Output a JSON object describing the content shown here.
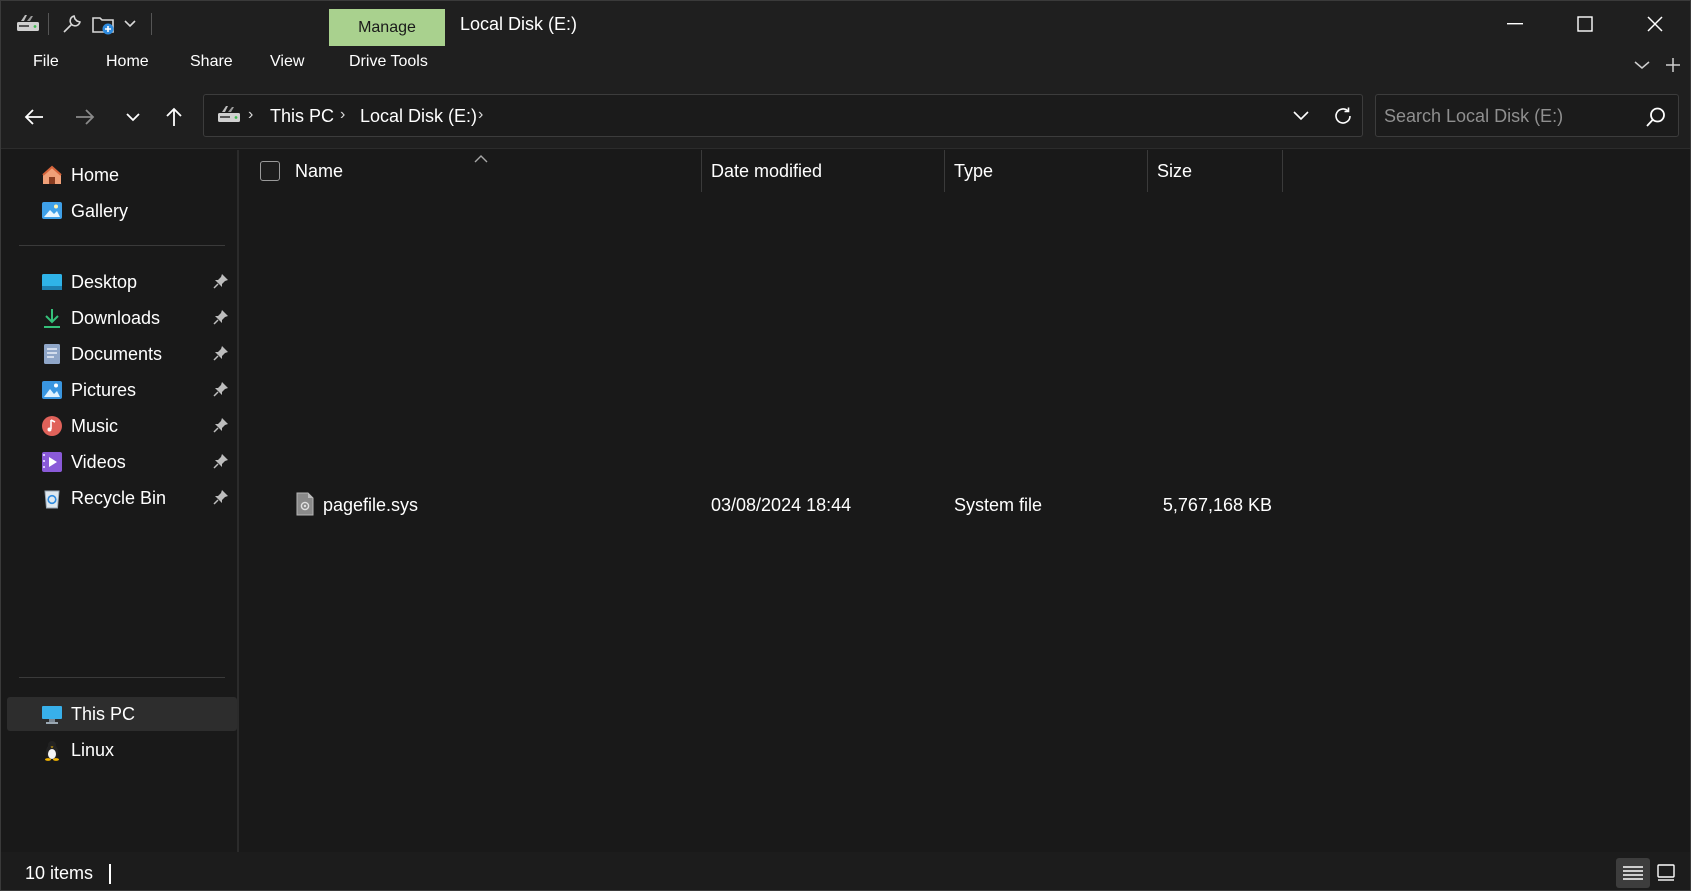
{
  "titlebar": {
    "manage_tab": "Manage",
    "window_title": "Local Disk (E:)"
  },
  "ribbon": {
    "tabs": [
      "File",
      "Home",
      "Share",
      "View",
      "Drive Tools"
    ]
  },
  "addressbar": {
    "crumbs": [
      "This PC",
      "Local Disk (E:)"
    ]
  },
  "search": {
    "placeholder": "Search Local Disk (E:)"
  },
  "sidebar": {
    "top_items": [
      {
        "label": "Home",
        "icon": "home-icon"
      },
      {
        "label": "Gallery",
        "icon": "gallery-icon"
      }
    ],
    "pinned_items": [
      {
        "label": "Desktop",
        "icon": "desktop-folder-icon"
      },
      {
        "label": "Downloads",
        "icon": "downloads-folder-icon"
      },
      {
        "label": "Documents",
        "icon": "documents-folder-icon"
      },
      {
        "label": "Pictures",
        "icon": "pictures-folder-icon"
      },
      {
        "label": "Music",
        "icon": "music-folder-icon"
      },
      {
        "label": "Videos",
        "icon": "videos-folder-icon"
      },
      {
        "label": "Recycle Bin",
        "icon": "recycle-bin-icon"
      }
    ],
    "bottom_items": [
      {
        "label": "This PC",
        "icon": "this-pc-icon",
        "selected": true
      },
      {
        "label": "Linux",
        "icon": "linux-penguin-icon"
      }
    ]
  },
  "columns": {
    "name": "Name",
    "date_modified": "Date modified",
    "type": "Type",
    "size": "Size"
  },
  "files": [
    {
      "name": "pagefile.sys",
      "date_modified": "03/08/2024 18:44",
      "type": "System file",
      "size": "5,767,168 KB",
      "icon": "system-file-icon"
    }
  ],
  "statusbar": {
    "item_count": "10 items"
  },
  "colors": {
    "background": "#191919",
    "chrome": "#1f1f1f",
    "manage_accent": "#a9d18e",
    "selected_item": "#2d2d2d"
  }
}
